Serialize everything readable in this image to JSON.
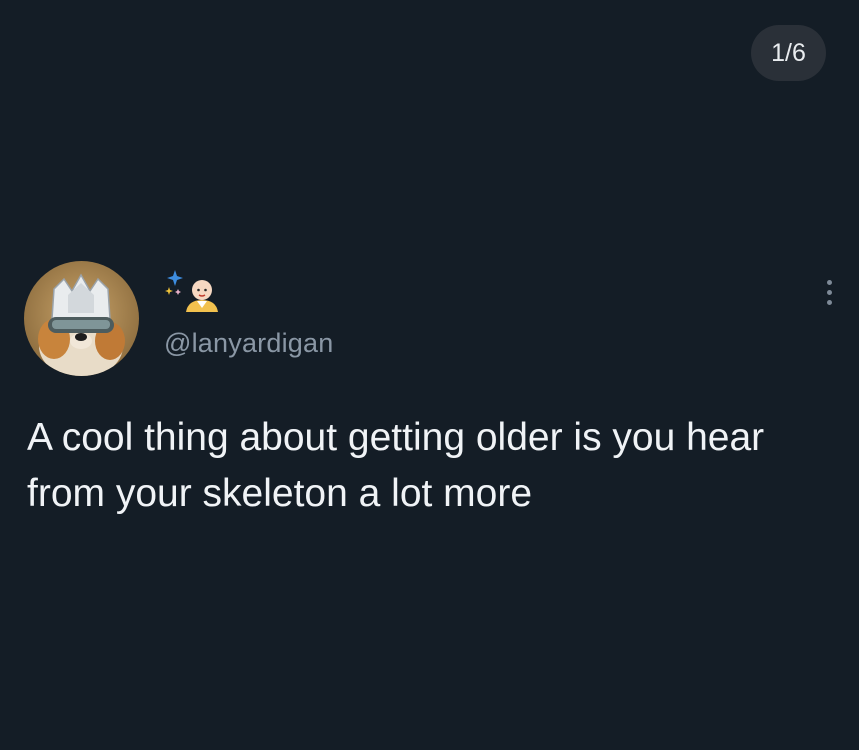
{
  "pager": {
    "counter": "1/6"
  },
  "tweet": {
    "author": {
      "avatar_icon": "masked-dog-avatar",
      "display_name_icons": [
        "sparkles-icon",
        "bald-person-emoji-icon"
      ],
      "handle": "@lanyardigan"
    },
    "more_icon": "vertical-ellipsis-icon",
    "text": "A cool thing about getting older is you hear from your skeleton a lot more"
  },
  "colors": {
    "background": "#141d26",
    "counter_bg": "#2a3038",
    "handle": "#8a97a5",
    "text": "#f0f3f6"
  }
}
